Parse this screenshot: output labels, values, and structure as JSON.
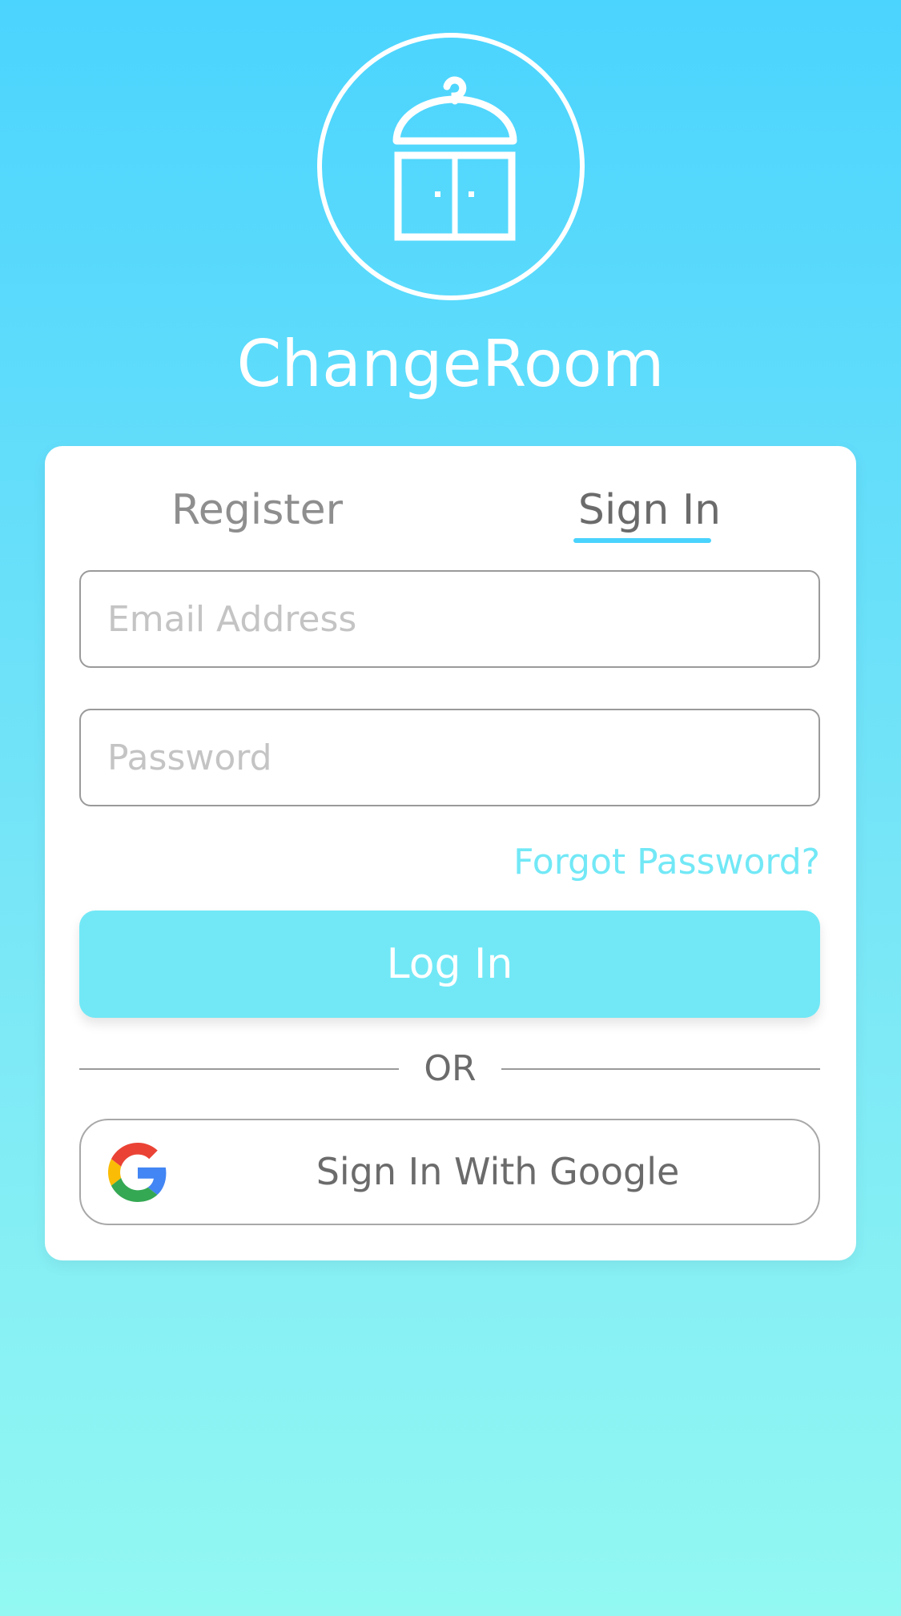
{
  "app": {
    "title": "ChangeRoom",
    "logo_icon": "wardrobe-icon"
  },
  "tabs": [
    {
      "label": "Register",
      "active": false
    },
    {
      "label": "Sign In",
      "active": true
    }
  ],
  "form": {
    "email": {
      "value": "",
      "placeholder": "Email Address"
    },
    "password": {
      "value": "",
      "placeholder": "Password"
    },
    "forgot_label": "Forgot Password?",
    "login_label": "Log In",
    "divider_label": "OR",
    "google_label": "Sign In With Google",
    "google_icon": "google-icon"
  },
  "colors": {
    "accent": "#4ad3fd",
    "button": "#72e8f6",
    "gradient_top": "#4bd4fe",
    "gradient_bottom": "#93f8f2"
  }
}
